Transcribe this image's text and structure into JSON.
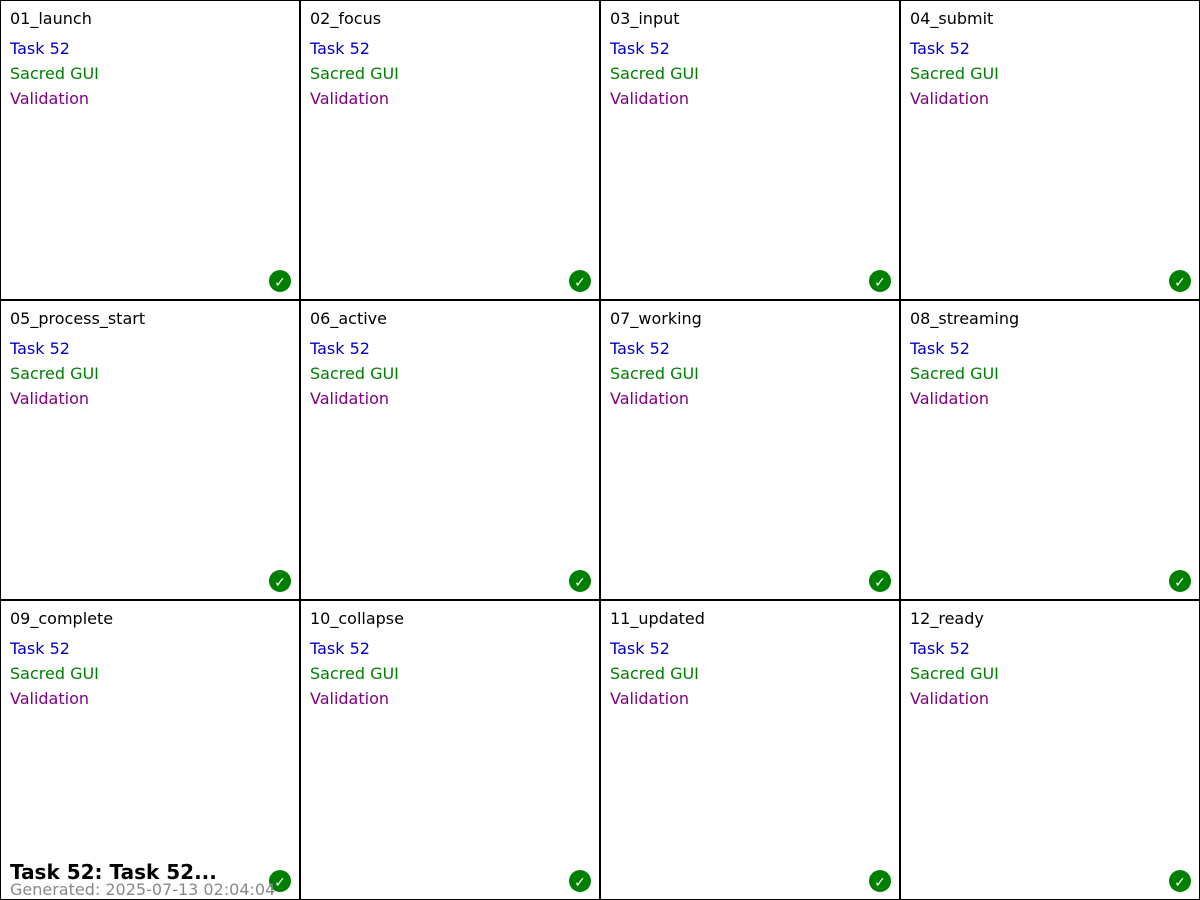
{
  "colors": {
    "task_text": "#0000cc",
    "subtitle_text": "#008000",
    "validation_text": "#800080",
    "check_badge": "#008000"
  },
  "check_icon": "checkmark-icon",
  "check_glyph": "✓",
  "panels": [
    {
      "title": "01_launch",
      "lines": [
        "Task 52",
        "Sacred GUI",
        "Validation"
      ]
    },
    {
      "title": "02_focus",
      "lines": [
        "Task 52",
        "Sacred GUI",
        "Validation"
      ]
    },
    {
      "title": "03_input",
      "lines": [
        "Task 52",
        "Sacred GUI",
        "Validation"
      ]
    },
    {
      "title": "04_submit",
      "lines": [
        "Task 52",
        "Sacred GUI",
        "Validation"
      ]
    },
    {
      "title": "05_process_start",
      "lines": [
        "Task 52",
        "Sacred GUI",
        "Validation"
      ]
    },
    {
      "title": "06_active",
      "lines": [
        "Task 52",
        "Sacred GUI",
        "Validation"
      ]
    },
    {
      "title": "07_working",
      "lines": [
        "Task 52",
        "Sacred GUI",
        "Validation"
      ]
    },
    {
      "title": "08_streaming",
      "lines": [
        "Task 52",
        "Sacred GUI",
        "Validation"
      ]
    },
    {
      "title": "09_complete",
      "lines": [
        "Task 52",
        "Sacred GUI",
        "Validation"
      ]
    },
    {
      "title": "10_collapse",
      "lines": [
        "Task 52",
        "Sacred GUI",
        "Validation"
      ]
    },
    {
      "title": "11_updated",
      "lines": [
        "Task 52",
        "Sacred GUI",
        "Validation"
      ]
    },
    {
      "title": "12_ready",
      "lines": [
        "Task 52",
        "Sacred GUI",
        "Validation"
      ]
    }
  ],
  "footer": {
    "title": "Task 52: Task 52...",
    "generated": "Generated: 2025-07-13 02:04:04"
  }
}
